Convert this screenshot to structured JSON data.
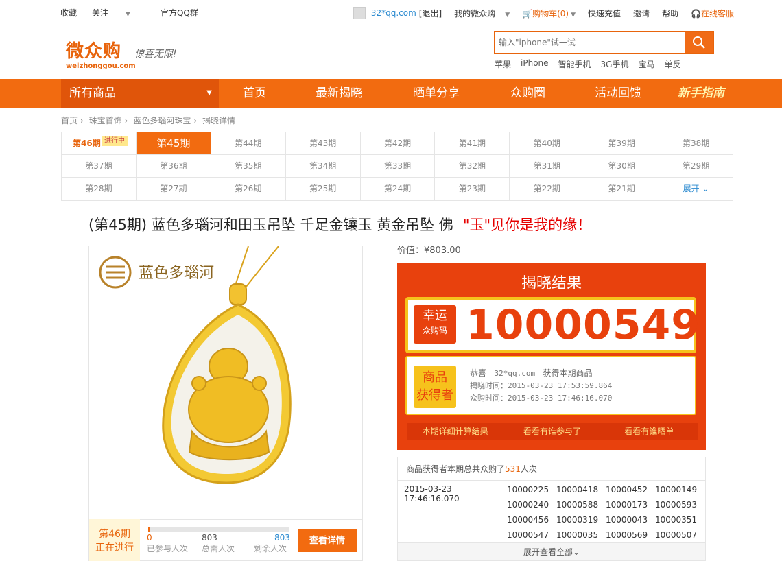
{
  "topbar": {
    "left": [
      "收藏",
      "关注",
      "官方QQ群"
    ],
    "user": "32*qq.com",
    "logout": "[退出]",
    "my": "我的微众购",
    "cart": "购物车(0)",
    "recharge": "快速充值",
    "invite": "邀请",
    "help": "帮助",
    "service": "在线客服"
  },
  "logo": {
    "name": "微众购",
    "domain": "weizhonggou.com",
    "slogan": "惊喜无限!"
  },
  "search": {
    "placeholder": "输入\"iphone\"试一试",
    "hot": [
      "苹果",
      "iPhone",
      "智能手机",
      "3G手机",
      "宝马",
      "单反"
    ]
  },
  "nav": {
    "all": "所有商品",
    "items": [
      "首页",
      "最新揭晓",
      "晒单分享",
      "众购圈",
      "活动回馈",
      "新手指南"
    ]
  },
  "breadcrumb": [
    "首页",
    "珠宝首饰",
    "蓝色多瑙河珠宝",
    "揭晓详情"
  ],
  "periods": {
    "next": "第46期",
    "next_tag": "进行中",
    "current": "第45期",
    "row1": [
      "第44期",
      "第43期",
      "第42期",
      "第41期",
      "第40期",
      "第39期",
      "第38期"
    ],
    "row2": [
      "第37期",
      "第36期",
      "第35期",
      "第34期",
      "第33期",
      "第32期",
      "第31期",
      "第30期",
      "第29期"
    ],
    "row3": [
      "第28期",
      "第27期",
      "第26期",
      "第25期",
      "第24期",
      "第23期",
      "第22期",
      "第21期"
    ],
    "expand": "展开"
  },
  "product": {
    "title": "(第45期)  蓝色多瑙河和田玉吊坠 千足金镶玉 黄金吊坠 佛",
    "tagline": "\"玉\"见你是我的缘！",
    "brand": "蓝色多瑙河",
    "price": "价值：¥803.00"
  },
  "next_bar": {
    "period": "第46期",
    "status": "正在进行",
    "joined": "0",
    "total": "803",
    "left": "803",
    "joined_label": "已参与人次",
    "total_label": "总需人次",
    "left_label": "剩余人次",
    "progress": 0.01,
    "button": "查看详情"
  },
  "result": {
    "heading": "揭晓结果",
    "lucky_l1": "幸运",
    "lucky_l2": "众购码",
    "code": "10000549",
    "winner_l1": "商品",
    "winner_l2": "获得者",
    "congrats": "恭喜",
    "user": "32*qq.com",
    "got": "获得本期商品",
    "reveal_time": "揭晓时间：2015-03-23 17:53:59.864",
    "buy_time": "众购时间：2015-03-23 17:46:16.070",
    "btn1": "本期详细计算结果",
    "btn2": "看看有谁参与了",
    "btn3": "看看有谁晒单"
  },
  "buys": {
    "header_pre": "商品获得者本期总共众购了",
    "count": "531",
    "header_post": "人次",
    "time": "2015-03-23 17:46:16.070",
    "codes": [
      [
        "10000225",
        "10000418",
        "10000452",
        "10000149"
      ],
      [
        "10000240",
        "10000588",
        "10000173",
        "10000593"
      ],
      [
        "10000456",
        "10000319",
        "10000043",
        "10000351"
      ],
      [
        "10000547",
        "10000035",
        "10000569",
        "10000507"
      ]
    ],
    "more": "展开查看全部"
  }
}
